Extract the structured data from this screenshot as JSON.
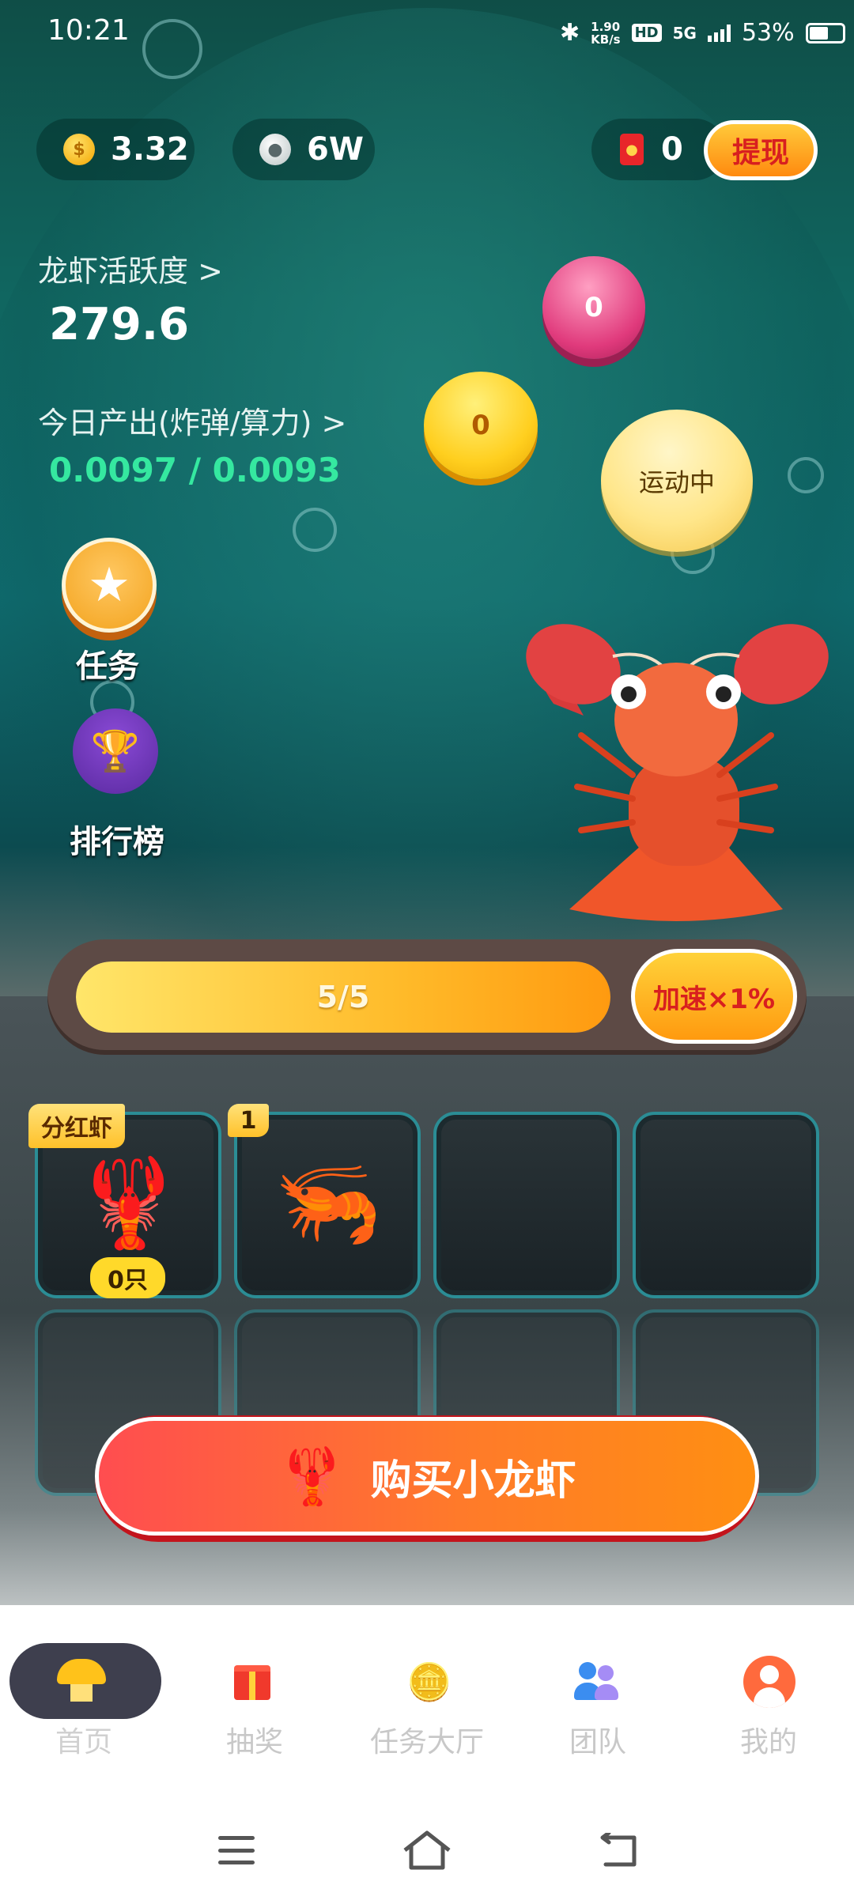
{
  "status_bar": {
    "time": "10:21",
    "speed_top": "1.90",
    "speed_unit": "KB/s",
    "hd": "HD",
    "network": "5G",
    "battery": "53%"
  },
  "header": {
    "coin_balance": "3.32",
    "silver_balance": "6W",
    "red_packet_count": "0",
    "withdraw_label": "提现"
  },
  "stats": {
    "activity_label": "龙虾活跃度 >",
    "activity_value": "279.6",
    "output_label": "今日产出(炸弹/算力) >",
    "output_value": "0.0097 / 0.0093"
  },
  "bubbles": {
    "pink_value": "0",
    "gold_value": "0",
    "status_label": "运动中"
  },
  "side_menu": {
    "tasks_label": "任务",
    "ranking_label": "排行榜"
  },
  "progress": {
    "text": "5/5",
    "value": 1.0,
    "speedup_label": "加速×1%"
  },
  "slots": {
    "slot1_tag": "分红虾",
    "slot1_count": "0只",
    "slot2_badge": "1"
  },
  "buy_button": {
    "label": "购买小龙虾"
  },
  "bottom_nav": {
    "items": [
      {
        "label": "首页"
      },
      {
        "label": "抽奖"
      },
      {
        "label": "任务大厅"
      },
      {
        "label": "团队"
      },
      {
        "label": "我的"
      }
    ]
  },
  "colors": {
    "accent_orange": "#ff8f12",
    "teal_bg": "#0f6a6d",
    "green_value": "#35e8a0"
  }
}
